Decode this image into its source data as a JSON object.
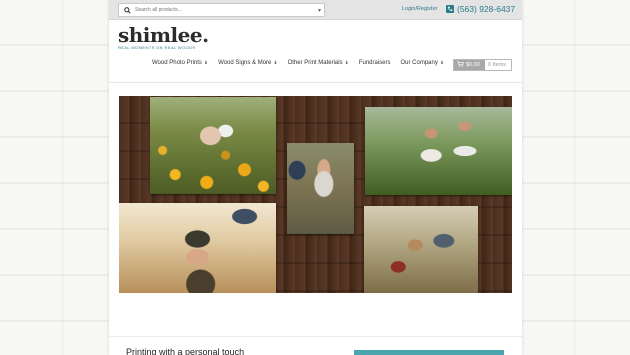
{
  "topbar": {
    "search_placeholder": "Search all products...",
    "login_label": "Login/Register",
    "phone": "(563) 928-6437"
  },
  "brand": {
    "name": "shimlee.",
    "tagline": "REAL MOMENTS ON REAL WOOD®"
  },
  "nav": {
    "items": [
      {
        "label": "Wood Photo Prints",
        "has_dropdown": true
      },
      {
        "label": "Wood Signs & More",
        "has_dropdown": true
      },
      {
        "label": "Other Print Materials",
        "has_dropdown": true
      },
      {
        "label": "Fundraisers",
        "has_dropdown": false
      },
      {
        "label": "Our Company",
        "has_dropdown": true
      }
    ]
  },
  "cart": {
    "amount": "$0.00",
    "items": "0 Items"
  },
  "hero": {
    "photos": [
      "sunflower-field-family",
      "toddler-standing",
      "kids-in-field",
      "toddler-held-hands",
      "family-walking-path"
    ]
  },
  "intro": {
    "heading": "Printing with a personal touch"
  },
  "colors": {
    "accent": "#2a7c8a",
    "cta": "#4ba5ae",
    "topbar": "#e4e4e4"
  }
}
